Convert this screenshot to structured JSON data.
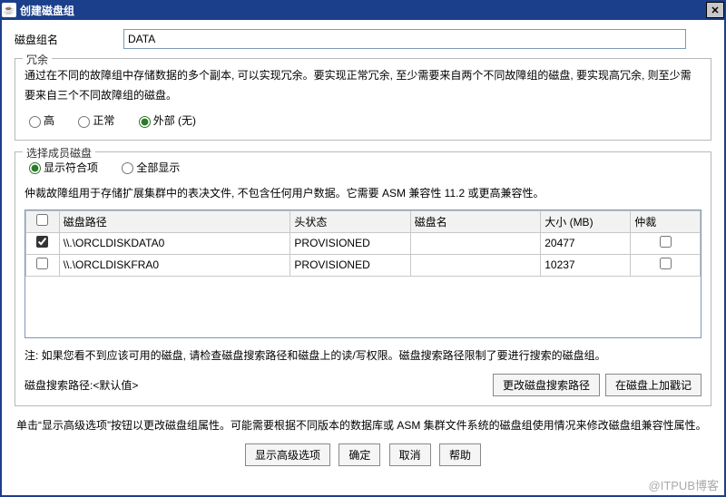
{
  "window": {
    "title": "创建磁盘组"
  },
  "form": {
    "name_label": "磁盘组名",
    "name_value": "DATA"
  },
  "redundancy": {
    "legend": "冗余",
    "desc": "通过在不同的故障组中存储数据的多个副本, 可以实现冗余。要实现正常冗余, 至少需要来自两个不同故障组的磁盘, 要实现高冗余, 则至少需要来自三个不同故障组的磁盘。",
    "opts": {
      "high": "高",
      "normal": "正常",
      "external": "外部 (无)"
    }
  },
  "members": {
    "legend": "选择成员磁盘",
    "show_eligible": "显示符合项",
    "show_all": "全部显示",
    "quorum_desc": "仲裁故障组用于存储扩展集群中的表决文件, 不包含任何用户数据。它需要 ASM 兼容性 11.2 或更高兼容性。",
    "cols": {
      "path": "磁盘路径",
      "header": "头状态",
      "name": "磁盘名",
      "size": "大小 (MB)",
      "quorum": "仲裁"
    },
    "rows": [
      {
        "checked": true,
        "path": "\\\\.\\ORCLDISKDATA0",
        "header": "PROVISIONED",
        "name": "",
        "size": "20477",
        "quorum": false
      },
      {
        "checked": false,
        "path": "\\\\.\\ORCLDISKFRA0",
        "header": "PROVISIONED",
        "name": "",
        "size": "10237",
        "quorum": false
      }
    ],
    "note": "注: 如果您看不到应该可用的磁盘, 请检查磁盘搜索路径和磁盘上的读/写权限。磁盘搜索路径限制了要进行搜索的磁盘组。",
    "path_label": "磁盘搜索路径:<默认值>",
    "change_path_btn": "更改磁盘搜索路径",
    "stamp_btn": "在磁盘上加戳记"
  },
  "bottom_note": "单击“显示高级选项”按钮以更改磁盘组属性。可能需要根据不同版本的数据库或 ASM 集群文件系统的磁盘组使用情况来修改磁盘组兼容性属性。",
  "buttons": {
    "adv": "显示高级选项",
    "ok": "确定",
    "cancel": "取消",
    "help": "帮助"
  },
  "watermark": "@ITPUB博客"
}
